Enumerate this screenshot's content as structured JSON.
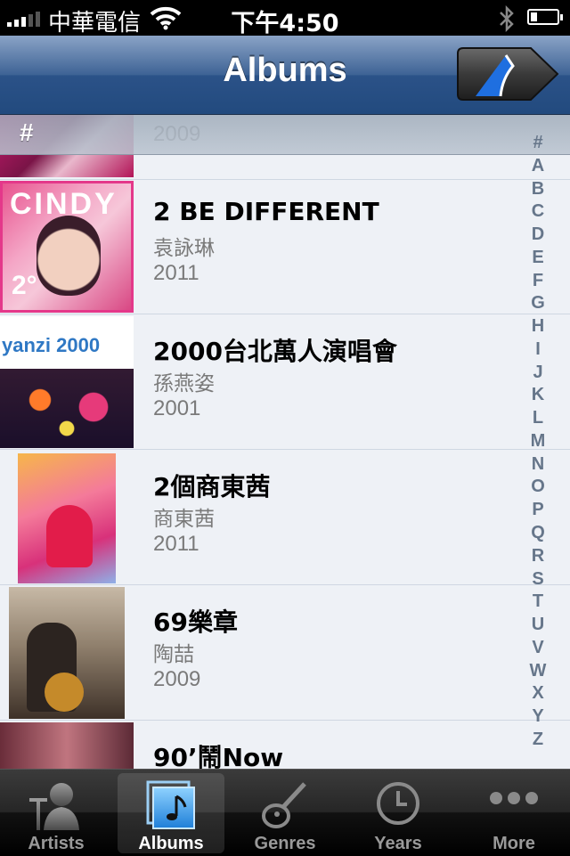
{
  "status_bar": {
    "carrier": "中華電信",
    "time": "下午4:50"
  },
  "nav": {
    "title": "Albums",
    "now_playing_icon": "now-playing-arrow-icon"
  },
  "section_header": "#",
  "partial_row": {
    "year": "2009"
  },
  "albums": [
    {
      "title": "2 BE DIFFERENT",
      "artist": "袁詠琳",
      "year": "2011",
      "cover_text": "CINDY",
      "cover_mark": "2°"
    },
    {
      "title": "2000台北萬人演唱會",
      "artist": "孫燕姿",
      "year": "2001",
      "cover_text": "yanzi 2000"
    },
    {
      "title": "2個商東茜",
      "artist": "商東茜",
      "year": "2011"
    },
    {
      "title": "69樂章",
      "artist": "陶喆",
      "year": "2009"
    },
    {
      "title": "90’鬧Now"
    }
  ],
  "index": [
    "#",
    "A",
    "B",
    "C",
    "D",
    "E",
    "F",
    "G",
    "H",
    "I",
    "J",
    "K",
    "L",
    "M",
    "N",
    "O",
    "P",
    "Q",
    "R",
    "S",
    "T",
    "U",
    "V",
    "W",
    "X",
    "Y",
    "Z"
  ],
  "tabs": [
    {
      "label": "Artists",
      "icon": "artist-silhouette-icon",
      "active": false
    },
    {
      "label": "Albums",
      "icon": "album-music-icon",
      "active": true
    },
    {
      "label": "Genres",
      "icon": "guitar-icon",
      "active": false
    },
    {
      "label": "Years",
      "icon": "clock-icon",
      "active": false
    },
    {
      "label": "More",
      "icon": "more-dots-icon",
      "active": false
    }
  ],
  "colors": {
    "nav_bar": "#2b5288",
    "active_tab_icon": "#3fa7f5",
    "index_letters": "#66768a"
  }
}
